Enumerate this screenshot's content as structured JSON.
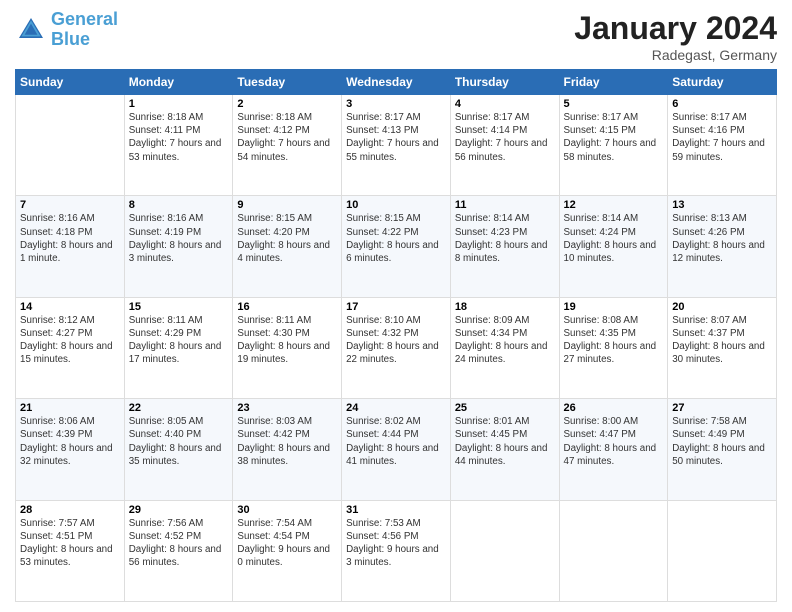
{
  "logo": {
    "line1": "General",
    "line2": "Blue"
  },
  "title": "January 2024",
  "location": "Radegast, Germany",
  "days_header": [
    "Sunday",
    "Monday",
    "Tuesday",
    "Wednesday",
    "Thursday",
    "Friday",
    "Saturday"
  ],
  "weeks": [
    [
      {
        "day": "",
        "sunrise": "",
        "sunset": "",
        "daylight": ""
      },
      {
        "day": "1",
        "sunrise": "Sunrise: 8:18 AM",
        "sunset": "Sunset: 4:11 PM",
        "daylight": "Daylight: 7 hours and 53 minutes."
      },
      {
        "day": "2",
        "sunrise": "Sunrise: 8:18 AM",
        "sunset": "Sunset: 4:12 PM",
        "daylight": "Daylight: 7 hours and 54 minutes."
      },
      {
        "day": "3",
        "sunrise": "Sunrise: 8:17 AM",
        "sunset": "Sunset: 4:13 PM",
        "daylight": "Daylight: 7 hours and 55 minutes."
      },
      {
        "day": "4",
        "sunrise": "Sunrise: 8:17 AM",
        "sunset": "Sunset: 4:14 PM",
        "daylight": "Daylight: 7 hours and 56 minutes."
      },
      {
        "day": "5",
        "sunrise": "Sunrise: 8:17 AM",
        "sunset": "Sunset: 4:15 PM",
        "daylight": "Daylight: 7 hours and 58 minutes."
      },
      {
        "day": "6",
        "sunrise": "Sunrise: 8:17 AM",
        "sunset": "Sunset: 4:16 PM",
        "daylight": "Daylight: 7 hours and 59 minutes."
      }
    ],
    [
      {
        "day": "7",
        "sunrise": "Sunrise: 8:16 AM",
        "sunset": "Sunset: 4:18 PM",
        "daylight": "Daylight: 8 hours and 1 minute."
      },
      {
        "day": "8",
        "sunrise": "Sunrise: 8:16 AM",
        "sunset": "Sunset: 4:19 PM",
        "daylight": "Daylight: 8 hours and 3 minutes."
      },
      {
        "day": "9",
        "sunrise": "Sunrise: 8:15 AM",
        "sunset": "Sunset: 4:20 PM",
        "daylight": "Daylight: 8 hours and 4 minutes."
      },
      {
        "day": "10",
        "sunrise": "Sunrise: 8:15 AM",
        "sunset": "Sunset: 4:22 PM",
        "daylight": "Daylight: 8 hours and 6 minutes."
      },
      {
        "day": "11",
        "sunrise": "Sunrise: 8:14 AM",
        "sunset": "Sunset: 4:23 PM",
        "daylight": "Daylight: 8 hours and 8 minutes."
      },
      {
        "day": "12",
        "sunrise": "Sunrise: 8:14 AM",
        "sunset": "Sunset: 4:24 PM",
        "daylight": "Daylight: 8 hours and 10 minutes."
      },
      {
        "day": "13",
        "sunrise": "Sunrise: 8:13 AM",
        "sunset": "Sunset: 4:26 PM",
        "daylight": "Daylight: 8 hours and 12 minutes."
      }
    ],
    [
      {
        "day": "14",
        "sunrise": "Sunrise: 8:12 AM",
        "sunset": "Sunset: 4:27 PM",
        "daylight": "Daylight: 8 hours and 15 minutes."
      },
      {
        "day": "15",
        "sunrise": "Sunrise: 8:11 AM",
        "sunset": "Sunset: 4:29 PM",
        "daylight": "Daylight: 8 hours and 17 minutes."
      },
      {
        "day": "16",
        "sunrise": "Sunrise: 8:11 AM",
        "sunset": "Sunset: 4:30 PM",
        "daylight": "Daylight: 8 hours and 19 minutes."
      },
      {
        "day": "17",
        "sunrise": "Sunrise: 8:10 AM",
        "sunset": "Sunset: 4:32 PM",
        "daylight": "Daylight: 8 hours and 22 minutes."
      },
      {
        "day": "18",
        "sunrise": "Sunrise: 8:09 AM",
        "sunset": "Sunset: 4:34 PM",
        "daylight": "Daylight: 8 hours and 24 minutes."
      },
      {
        "day": "19",
        "sunrise": "Sunrise: 8:08 AM",
        "sunset": "Sunset: 4:35 PM",
        "daylight": "Daylight: 8 hours and 27 minutes."
      },
      {
        "day": "20",
        "sunrise": "Sunrise: 8:07 AM",
        "sunset": "Sunset: 4:37 PM",
        "daylight": "Daylight: 8 hours and 30 minutes."
      }
    ],
    [
      {
        "day": "21",
        "sunrise": "Sunrise: 8:06 AM",
        "sunset": "Sunset: 4:39 PM",
        "daylight": "Daylight: 8 hours and 32 minutes."
      },
      {
        "day": "22",
        "sunrise": "Sunrise: 8:05 AM",
        "sunset": "Sunset: 4:40 PM",
        "daylight": "Daylight: 8 hours and 35 minutes."
      },
      {
        "day": "23",
        "sunrise": "Sunrise: 8:03 AM",
        "sunset": "Sunset: 4:42 PM",
        "daylight": "Daylight: 8 hours and 38 minutes."
      },
      {
        "day": "24",
        "sunrise": "Sunrise: 8:02 AM",
        "sunset": "Sunset: 4:44 PM",
        "daylight": "Daylight: 8 hours and 41 minutes."
      },
      {
        "day": "25",
        "sunrise": "Sunrise: 8:01 AM",
        "sunset": "Sunset: 4:45 PM",
        "daylight": "Daylight: 8 hours and 44 minutes."
      },
      {
        "day": "26",
        "sunrise": "Sunrise: 8:00 AM",
        "sunset": "Sunset: 4:47 PM",
        "daylight": "Daylight: 8 hours and 47 minutes."
      },
      {
        "day": "27",
        "sunrise": "Sunrise: 7:58 AM",
        "sunset": "Sunset: 4:49 PM",
        "daylight": "Daylight: 8 hours and 50 minutes."
      }
    ],
    [
      {
        "day": "28",
        "sunrise": "Sunrise: 7:57 AM",
        "sunset": "Sunset: 4:51 PM",
        "daylight": "Daylight: 8 hours and 53 minutes."
      },
      {
        "day": "29",
        "sunrise": "Sunrise: 7:56 AM",
        "sunset": "Sunset: 4:52 PM",
        "daylight": "Daylight: 8 hours and 56 minutes."
      },
      {
        "day": "30",
        "sunrise": "Sunrise: 7:54 AM",
        "sunset": "Sunset: 4:54 PM",
        "daylight": "Daylight: 9 hours and 0 minutes."
      },
      {
        "day": "31",
        "sunrise": "Sunrise: 7:53 AM",
        "sunset": "Sunset: 4:56 PM",
        "daylight": "Daylight: 9 hours and 3 minutes."
      },
      {
        "day": "",
        "sunrise": "",
        "sunset": "",
        "daylight": ""
      },
      {
        "day": "",
        "sunrise": "",
        "sunset": "",
        "daylight": ""
      },
      {
        "day": "",
        "sunrise": "",
        "sunset": "",
        "daylight": ""
      }
    ]
  ]
}
